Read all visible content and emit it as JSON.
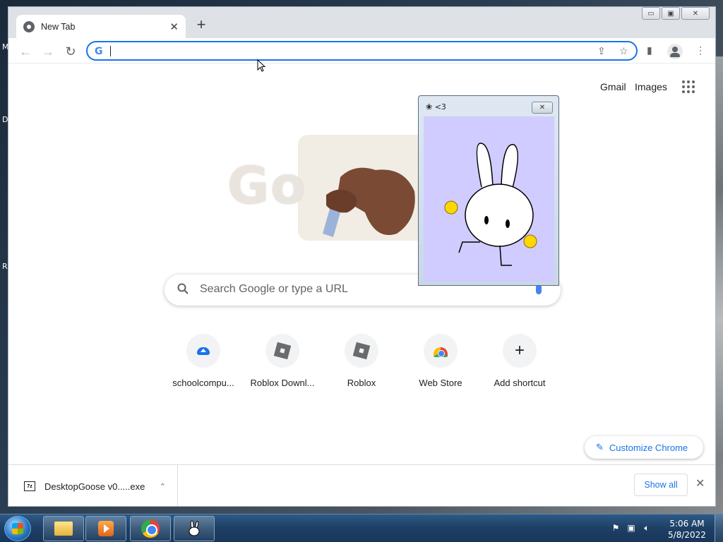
{
  "desktop": {
    "fragments": [
      "M",
      "D",
      "R"
    ]
  },
  "browser": {
    "tab": {
      "title": "New Tab"
    },
    "new_tab_symbol": "+",
    "window_controls": {
      "minimize": "▭",
      "restore": "▣",
      "close": "✕"
    },
    "address_bar": {
      "value": ""
    },
    "nav": {
      "back": "←",
      "forward": "→",
      "reload": "↻"
    }
  },
  "page": {
    "top_links": [
      "Gmail",
      "Images"
    ],
    "doodle_text": "Go",
    "search": {
      "placeholder": "Search Google or type a URL"
    },
    "shortcuts": [
      {
        "label": "schoolcompu...",
        "icon": "cloud-upload-icon"
      },
      {
        "label": "Roblox Downl...",
        "icon": "roblox-icon"
      },
      {
        "label": "Roblox",
        "icon": "roblox-icon"
      },
      {
        "label": "Web Store",
        "icon": "webstore-icon"
      },
      {
        "label": "Add shortcut",
        "icon": "plus-icon"
      }
    ],
    "customize_label": "Customize Chrome"
  },
  "downloads": {
    "file_name": "DesktopGoose v0.....exe",
    "file_icon_text": "7z",
    "show_all_label": "Show all"
  },
  "popup": {
    "title": "<3",
    "close_symbol": "✕"
  },
  "taskbar": {
    "time": "5:06 AM",
    "date": "5/8/2022"
  },
  "colors": {
    "accent": "#1a73e8",
    "popup_bg": "#d0ccff",
    "taskbar": "#1d3f63"
  }
}
